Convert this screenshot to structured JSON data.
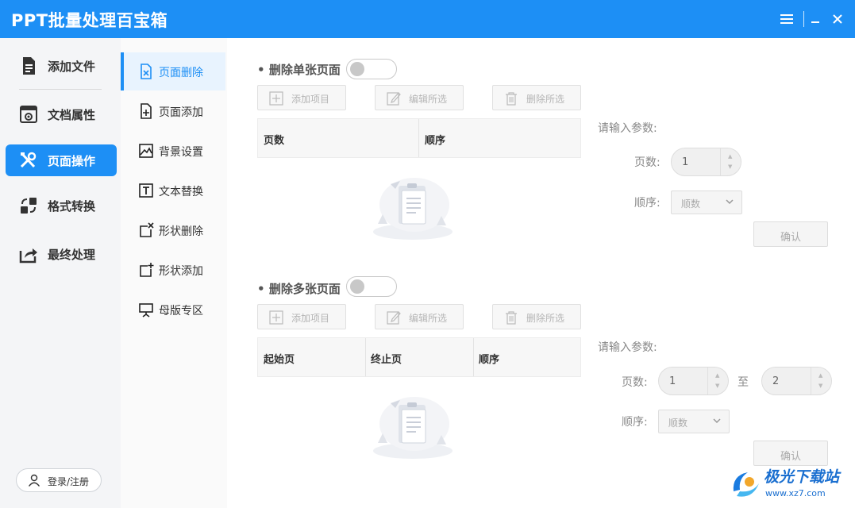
{
  "app": {
    "title": "PPT批量处理百宝箱"
  },
  "titlebar": {
    "menu_icon": "hamburger-icon",
    "minimize_icon": "minimize-icon",
    "close_icon": "close-icon"
  },
  "sidebar": {
    "items": [
      {
        "label": "添加文件",
        "icon": "document-icon",
        "active": false
      },
      {
        "label": "文档属性",
        "icon": "doc-settings-icon",
        "active": false
      },
      {
        "label": "页面操作",
        "icon": "tools-icon",
        "active": true
      },
      {
        "label": "格式转换",
        "icon": "convert-icon",
        "active": false
      },
      {
        "label": "最终处理",
        "icon": "share-icon",
        "active": false
      }
    ],
    "login_label": "登录/注册"
  },
  "subnav": {
    "items": [
      {
        "label": "页面删除",
        "active": true
      },
      {
        "label": "页面添加",
        "active": false
      },
      {
        "label": "背景设置",
        "active": false
      },
      {
        "label": "文本替换",
        "active": false
      },
      {
        "label": "形状删除",
        "active": false
      },
      {
        "label": "形状添加",
        "active": false
      },
      {
        "label": "母版专区",
        "active": false
      }
    ]
  },
  "single": {
    "title": "删除单张页面",
    "buttons": {
      "add": "添加项目",
      "edit": "编辑所选",
      "delete": "删除所选"
    },
    "columns": [
      "页数",
      "顺序"
    ],
    "params": {
      "title": "请输入参数:",
      "pages_label": "页数:",
      "pages_value": "1",
      "order_label": "顺序:",
      "order_value": "顺数",
      "confirm": "确认"
    }
  },
  "multi": {
    "title": "删除多张页面",
    "buttons": {
      "add": "添加项目",
      "edit": "编辑所选",
      "delete": "删除所选"
    },
    "columns": [
      "起始页",
      "终止页",
      "顺序"
    ],
    "params": {
      "title": "请输入参数:",
      "pages_label": "页数:",
      "from_value": "1",
      "to_label": "至",
      "to_value": "2",
      "order_label": "顺序:",
      "order_value": "顺数",
      "confirm": "确认"
    }
  },
  "colors": {
    "accent": "#1d8ff5",
    "sidebar_bg": "#f4f5f7",
    "subnav_bg": "#fafafa"
  }
}
